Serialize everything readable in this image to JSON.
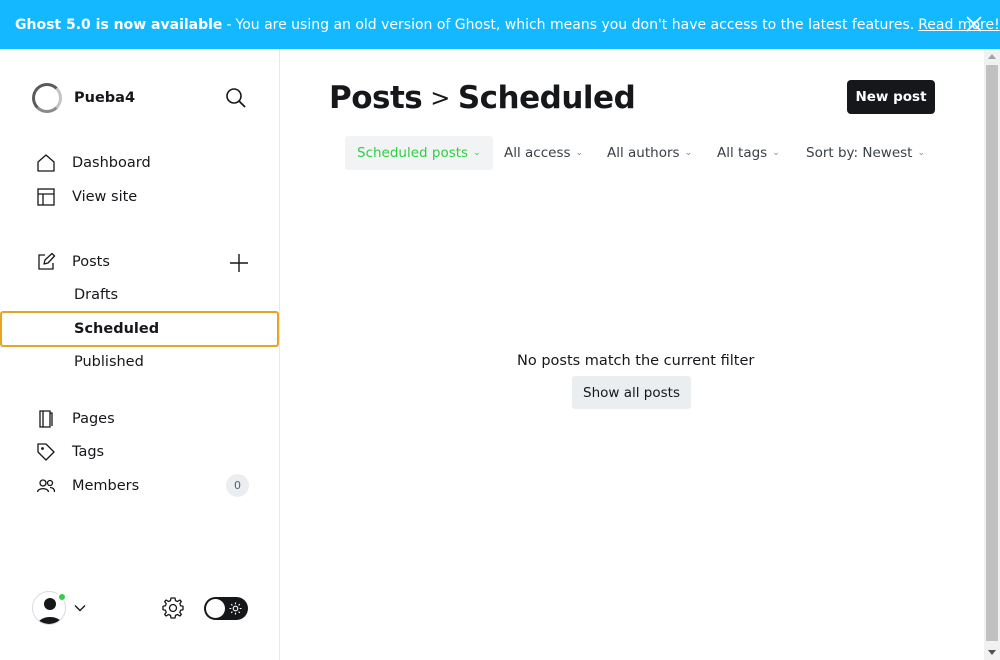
{
  "banner": {
    "headline": "Ghost 5.0 is now available",
    "separator": "-",
    "message": "You are using an old version of Ghost, which means you don't have access to the latest features.",
    "link": "Read more!",
    "background": "#14b8ff"
  },
  "sidebar": {
    "site_name": "Pueba4",
    "nav": {
      "dashboard": "Dashboard",
      "view_site": "View site",
      "posts": "Posts",
      "pages": "Pages",
      "tags": "Tags",
      "members": "Members"
    },
    "posts_sub": {
      "drafts": "Drafts",
      "scheduled": "Scheduled",
      "published": "Published"
    },
    "members_count": "0",
    "active_border_color": "#e8a427",
    "online_dot_color": "#30cf43"
  },
  "header": {
    "crumb": "Posts",
    "separator": ">",
    "current": "Scheduled",
    "new_post": "New post"
  },
  "filters": {
    "type": "Scheduled posts",
    "access": "All access",
    "authors": "All authors",
    "tags": "All tags",
    "sort": "Sort by: Newest",
    "active_color": "#30cf43"
  },
  "empty_state": {
    "message": "No posts match the current filter",
    "button": "Show all posts"
  },
  "icons": [
    "close-icon",
    "search-icon",
    "home-icon",
    "layout-icon",
    "edit-icon",
    "plus-icon",
    "page-icon",
    "tag-icon",
    "members-icon",
    "user-icon",
    "chevron-down-icon",
    "gear-icon",
    "sun-icon"
  ]
}
